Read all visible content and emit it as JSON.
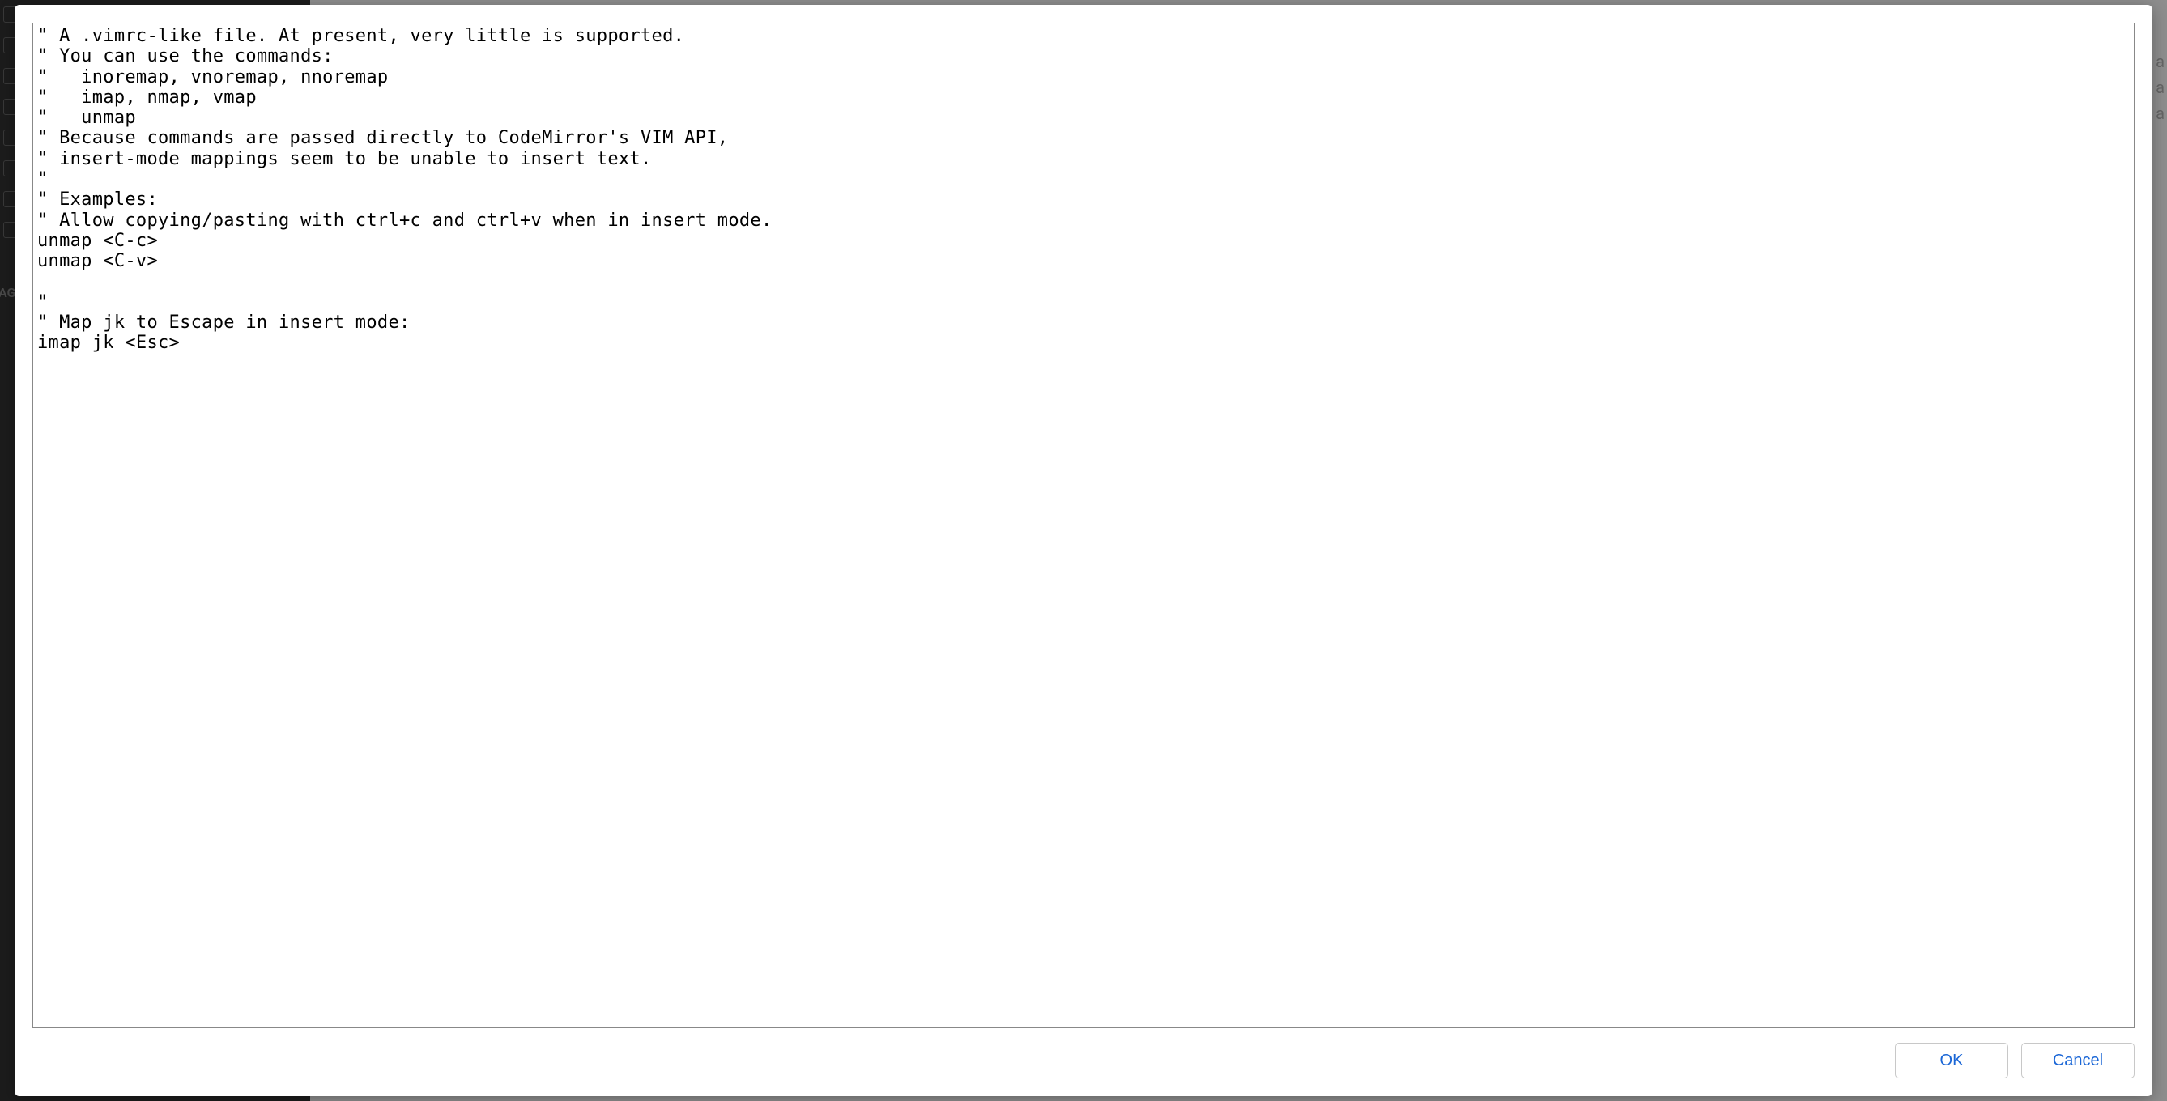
{
  "dialog": {
    "editor_content": "\" A .vimrc-like file. At present, very little is supported.\n\" You can use the commands:\n\"   inoremap, vnoremap, nnoremap\n\"   imap, nmap, vmap\n\"   unmap\n\" Because commands are passed directly to CodeMirror's VIM API,\n\" insert-mode mappings seem to be unable to insert text.\n\"\n\" Examples:\n\" Allow copying/pasting with ctrl+c and ctrl+v when in insert mode.\nunmap <C-c>\nunmap <C-v>\n\n\"\n\" Map jk to Escape in insert mode:\nimap jk <Esc>",
    "ok_label": "OK",
    "cancel_label": "Cancel"
  },
  "background": {
    "sidebar_tag": "AG"
  }
}
